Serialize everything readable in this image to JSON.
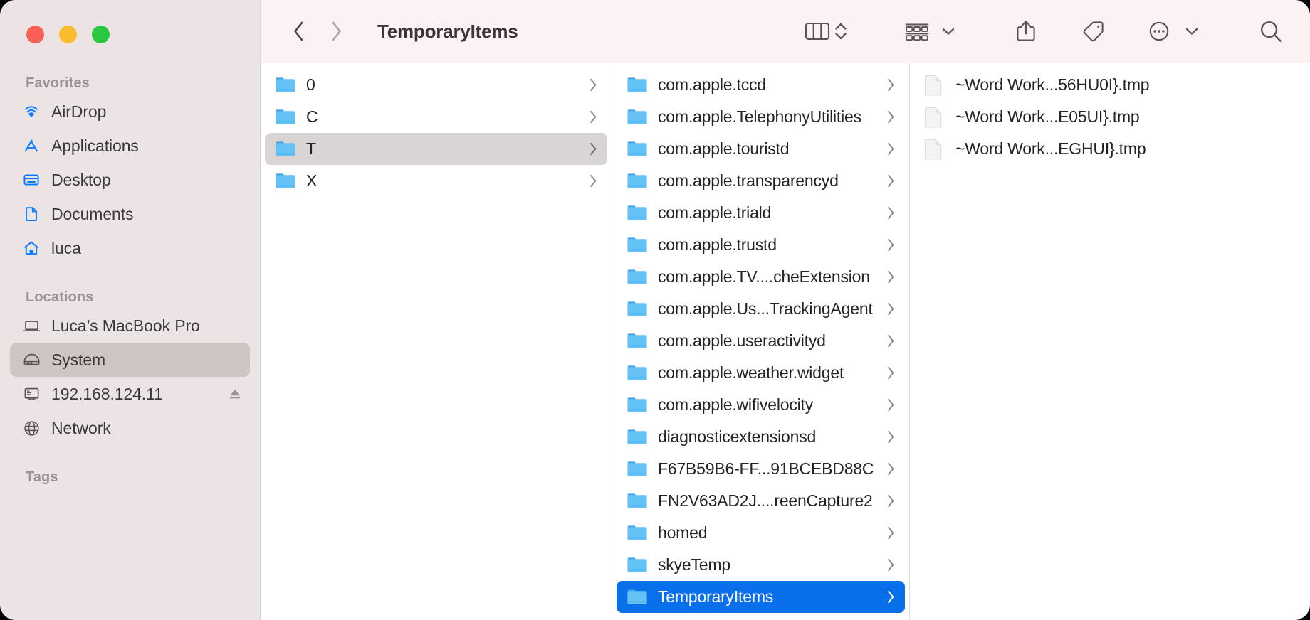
{
  "window": {
    "title": "TemporaryItems",
    "traffic_lights": [
      {
        "name": "close",
        "color": "#fb5f57"
      },
      {
        "name": "minimize",
        "color": "#fbbd2e"
      },
      {
        "name": "zoom",
        "color": "#29c840"
      }
    ]
  },
  "toolbar": {
    "back_label": "Back",
    "forward_label": "Forward",
    "view_mode": "Column View",
    "view_options_label": "View options",
    "group_label": "Group items",
    "share_label": "Share",
    "tags_label": "Tags",
    "more_label": "More",
    "search_label": "Search"
  },
  "sidebar": {
    "sections": [
      {
        "title": "Favorites",
        "items": [
          {
            "label": "AirDrop",
            "icon": "airdrop-icon",
            "selected": false
          },
          {
            "label": "Applications",
            "icon": "applications-icon",
            "selected": false
          },
          {
            "label": "Desktop",
            "icon": "desktop-icon",
            "selected": false
          },
          {
            "label": "Documents",
            "icon": "documents-icon",
            "selected": false
          },
          {
            "label": "luca",
            "icon": "home-icon",
            "selected": false
          }
        ]
      },
      {
        "title": "Locations",
        "items": [
          {
            "label": "Luca’s MacBook Pro",
            "icon": "laptop-icon",
            "selected": false
          },
          {
            "label": "System",
            "icon": "harddisk-icon",
            "selected": true
          },
          {
            "label": "192.168.124.11",
            "icon": "server-icon",
            "selected": false,
            "eject": true
          },
          {
            "label": "Network",
            "icon": "globe-icon",
            "selected": false
          }
        ]
      },
      {
        "title": "Tags",
        "items": []
      }
    ]
  },
  "columns": [
    {
      "name": "column-1",
      "items": [
        {
          "label": "0",
          "icon": "folder-icon",
          "chevron": true,
          "state": "none"
        },
        {
          "label": "C",
          "icon": "folder-icon",
          "chevron": true,
          "state": "none"
        },
        {
          "label": "T",
          "icon": "folder-icon",
          "chevron": true,
          "state": "gray"
        },
        {
          "label": "X",
          "icon": "folder-icon",
          "chevron": true,
          "state": "none"
        }
      ]
    },
    {
      "name": "column-2",
      "items": [
        {
          "label": "com.apple.tccd",
          "icon": "folder-icon",
          "chevron": true,
          "state": "none"
        },
        {
          "label": "com.apple.TelephonyUtilities",
          "icon": "folder-icon",
          "chevron": true,
          "state": "none"
        },
        {
          "label": "com.apple.touristd",
          "icon": "folder-icon",
          "chevron": true,
          "state": "none"
        },
        {
          "label": "com.apple.transparencyd",
          "icon": "folder-icon",
          "chevron": true,
          "state": "none"
        },
        {
          "label": "com.apple.triald",
          "icon": "folder-icon",
          "chevron": true,
          "state": "none"
        },
        {
          "label": "com.apple.trustd",
          "icon": "folder-icon",
          "chevron": true,
          "state": "none"
        },
        {
          "label": "com.apple.TV....cheExtension",
          "icon": "folder-icon",
          "chevron": true,
          "state": "none"
        },
        {
          "label": "com.apple.Us...TrackingAgent",
          "icon": "folder-icon",
          "chevron": true,
          "state": "none"
        },
        {
          "label": "com.apple.useractivityd",
          "icon": "folder-icon",
          "chevron": true,
          "state": "none"
        },
        {
          "label": "com.apple.weather.widget",
          "icon": "folder-icon",
          "chevron": true,
          "state": "none"
        },
        {
          "label": "com.apple.wifivelocity",
          "icon": "folder-icon",
          "chevron": true,
          "state": "none"
        },
        {
          "label": "diagnosticextensionsd",
          "icon": "folder-icon",
          "chevron": true,
          "state": "none"
        },
        {
          "label": "F67B59B6-FF...91BCEBD88C",
          "icon": "folder-icon",
          "chevron": true,
          "state": "none"
        },
        {
          "label": "FN2V63AD2J....reenCapture2",
          "icon": "folder-icon",
          "chevron": true,
          "state": "none"
        },
        {
          "label": "homed",
          "icon": "folder-icon",
          "chevron": true,
          "state": "none"
        },
        {
          "label": "skyeTemp",
          "icon": "folder-icon",
          "chevron": true,
          "state": "none"
        },
        {
          "label": "TemporaryItems",
          "icon": "folder-icon",
          "chevron": true,
          "state": "blue"
        }
      ]
    },
    {
      "name": "column-3",
      "items": [
        {
          "label": "~Word Work...56HU0I}.tmp",
          "icon": "file-icon",
          "chevron": false,
          "state": "none"
        },
        {
          "label": "~Word Work...E05UI}.tmp",
          "icon": "file-icon",
          "chevron": false,
          "state": "none"
        },
        {
          "label": "~Word Work...EGHUI}.tmp",
          "icon": "file-icon",
          "chevron": false,
          "state": "none"
        }
      ]
    }
  ],
  "colors": {
    "selection_blue": "#0a6fea",
    "selection_gray": "#d8d5d4",
    "sidebar_bg": "#ece4e4",
    "toolbar_bg": "#fdf2f3",
    "folder_blue": "#53b8f5",
    "sidebar_icon_blue": "#0a7cff"
  }
}
